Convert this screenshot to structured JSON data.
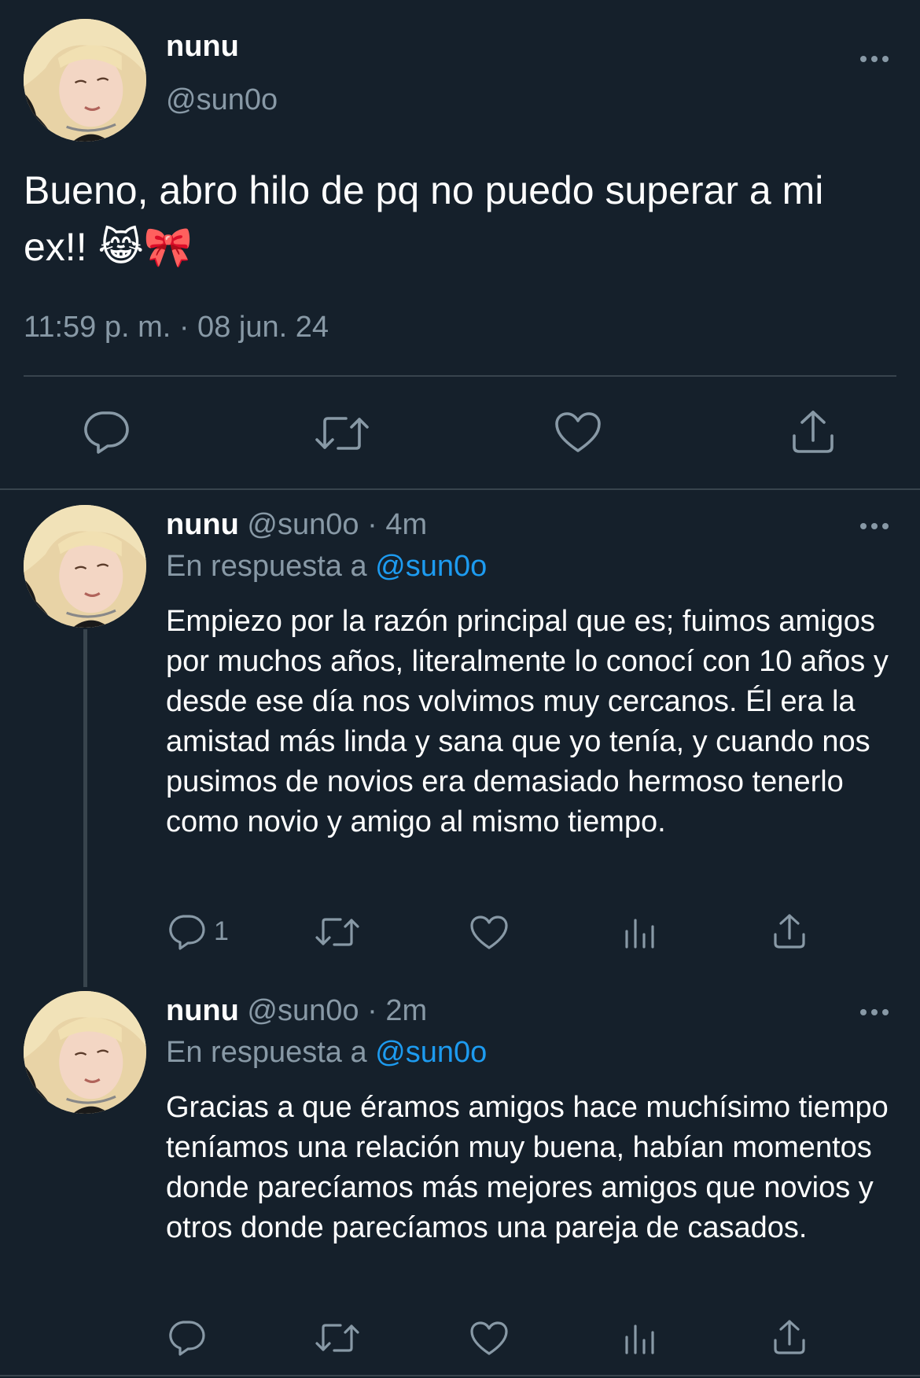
{
  "main_tweet": {
    "name": "nunu",
    "handle": "@sun0o",
    "text": "Bueno, abro hilo de pq no puedo superar a mi ex!!",
    "emojis": "😹🎀",
    "timestamp": "11:59 p. m. · 08 jun. 24",
    "actions": [
      "reply-icon",
      "retweet-icon",
      "like-icon",
      "share-icon"
    ]
  },
  "replies": [
    {
      "name": "nunu",
      "handle": "@sun0o",
      "time": "· 4m",
      "reply_prefix": "En respuesta a",
      "reply_to": "@sun0o",
      "text": "Empiezo por la razón principal que es; fuimos amigos por muchos años, literalmente lo conocí con 10 años y desde ese día nos volvimos muy cercanos. Él era la amistad más linda y sana que yo tenía, y cuando nos pusimos de novios era demasiado hermoso tenerlo como novio y amigo al mismo tiempo.",
      "reply_count": "1"
    },
    {
      "name": "nunu",
      "handle": "@sun0o",
      "time": "· 2m",
      "reply_prefix": "En respuesta a",
      "reply_to": "@sun0o",
      "text": "Gracias a que éramos amigos hace muchísimo tiempo teníamos una relación muy buena, habían momentos donde parecíamos más mejores amigos que novios y otros donde parecíamos una pareja de casados.",
      "reply_count": ""
    }
  ],
  "colors": {
    "background": "#15202b",
    "text": "#ffffff",
    "muted": "#8899a6",
    "link": "#1d9bf0",
    "divider": "#38444d"
  }
}
